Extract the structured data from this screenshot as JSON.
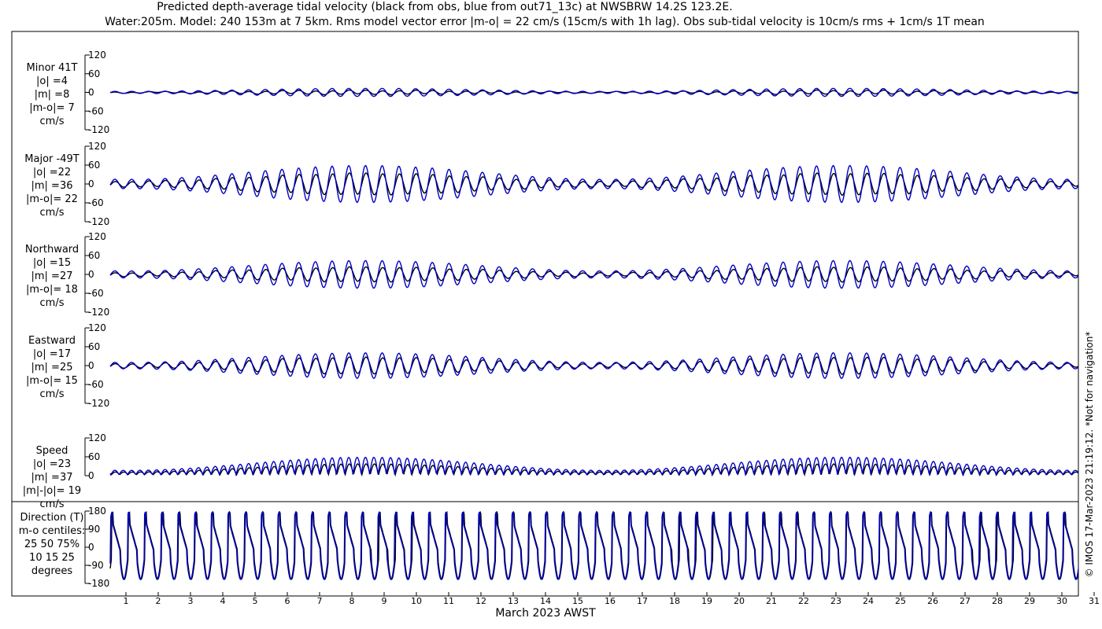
{
  "header": {
    "title_line1": "Predicted depth-average tidal velocity (black from obs, blue from out71_13c) at NWSBRW 14.2S 123.2E.",
    "title_line2": "Water:205m. Model: 240 153m at 7 5km. Rms model vector error |m-o| = 22 cm/s (15cm/s with 1h lag). Obs sub-tidal velocity is 10cm/s rms + 1cm/s 1T mean"
  },
  "footer": {
    "xlabel": "March 2023 AWST",
    "side_note": "© IMOS 17-Mar-2023 21:19:12. *Not for navigation*"
  },
  "colors": {
    "obs": "#000000",
    "model": "#0000cc",
    "axis": "#000000"
  },
  "chart_data": [
    {
      "type": "line",
      "panel": "minor",
      "labels": [
        "Minor 41T",
        "|o| =4",
        "|m| =8",
        "|m-o|= 7",
        "cm/s"
      ],
      "yticks": [
        120,
        60,
        0,
        -60,
        -120
      ],
      "ylim": [
        -120,
        120
      ],
      "x": [
        1,
        31
      ],
      "series": [
        {
          "color": "black",
          "amplitude": 4
        },
        {
          "color": "blue",
          "amplitude": 8
        }
      ]
    },
    {
      "type": "line",
      "panel": "major",
      "labels": [
        "Major -49T",
        "|o| =22",
        "|m| =36",
        "|m-o|= 22",
        "cm/s"
      ],
      "yticks": [
        120,
        60,
        0,
        -60,
        -120
      ],
      "ylim": [
        -120,
        120
      ],
      "x": [
        1,
        31
      ],
      "series": [
        {
          "color": "black",
          "amplitude": 22
        },
        {
          "color": "blue",
          "amplitude": 36
        }
      ]
    },
    {
      "type": "line",
      "panel": "northward",
      "labels": [
        "Northward",
        "|o| =15",
        "|m| =27",
        "|m-o|= 18",
        "cm/s"
      ],
      "yticks": [
        120,
        60,
        0,
        -60,
        -120
      ],
      "ylim": [
        -120,
        120
      ],
      "x": [
        1,
        31
      ],
      "series": [
        {
          "color": "black",
          "amplitude": 15
        },
        {
          "color": "blue",
          "amplitude": 27
        }
      ]
    },
    {
      "type": "line",
      "panel": "eastward",
      "labels": [
        "Eastward",
        "|o| =17",
        "|m| =25",
        "|m-o|= 15",
        "cm/s"
      ],
      "yticks": [
        120,
        60,
        0,
        -60,
        -120
      ],
      "ylim": [
        -120,
        120
      ],
      "x": [
        1,
        31
      ],
      "series": [
        {
          "color": "black",
          "amplitude": 17
        },
        {
          "color": "blue",
          "amplitude": 25
        }
      ]
    },
    {
      "type": "line",
      "panel": "speed",
      "labels": [
        "Speed",
        "|o| =23",
        "|m| =37",
        "|m|-|o|= 19",
        "cm/s"
      ],
      "yticks": [
        120,
        60,
        0
      ],
      "ylim": [
        0,
        120
      ],
      "x": [
        1,
        31
      ],
      "series": [
        {
          "color": "black",
          "amplitude": 23
        },
        {
          "color": "blue",
          "amplitude": 37
        }
      ]
    },
    {
      "type": "line",
      "panel": "direction",
      "labels": [
        "Direction (T)",
        "m-o centiles:",
        "25  50  75%",
        "10  15  25",
        "degrees"
      ],
      "yticks": [
        180,
        90,
        0,
        -90,
        -180
      ],
      "ylim": [
        -180,
        180
      ],
      "x": [
        1,
        31
      ],
      "series": [
        {
          "color": "black"
        },
        {
          "color": "blue"
        }
      ]
    }
  ],
  "xticks": [
    "1",
    "2",
    "3",
    "4",
    "5",
    "6",
    "7",
    "8",
    "9",
    "10",
    "11",
    "12",
    "13",
    "14",
    "15",
    "16",
    "17",
    "18",
    "19",
    "20",
    "21",
    "22",
    "23",
    "24",
    "25",
    "26",
    "27",
    "28",
    "29",
    "30",
    "31"
  ]
}
